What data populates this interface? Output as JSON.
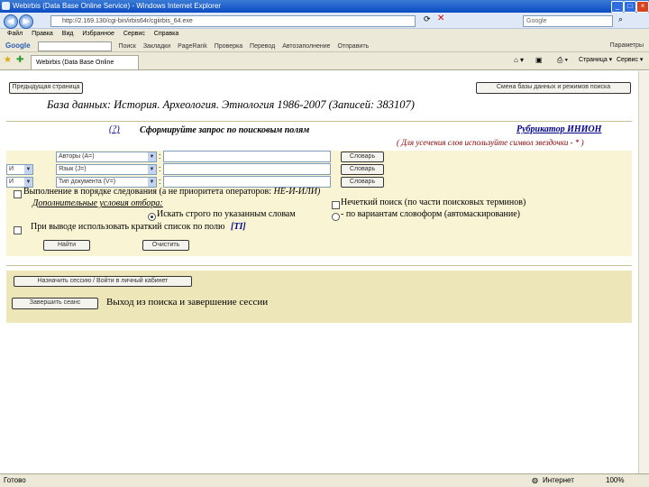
{
  "window": {
    "title": "Webirbis (Data Base Online Service) - Windows Internet Explorer"
  },
  "address": {
    "url": "http://2.169.130/cgi-bin/irbis64r/cgiirbis_64.exe",
    "search_placeholder": "Google"
  },
  "menu": [
    "Файл",
    "Правка",
    "Вид",
    "Избранное",
    "Сервис",
    "Справка"
  ],
  "google_bar": {
    "logo": "Google",
    "items": [
      "G",
      "Поиск",
      "Закладки",
      "PageRank",
      "Проверка",
      "Перевод",
      "Автозаполнение",
      "Отправить",
      "Параметры"
    ]
  },
  "tab": {
    "title": "Webirbis (Data Base Online Service)"
  },
  "page": {
    "btn_prev_page": "Предыдущая страница",
    "btn_change_db": "Смена базы данных и режимов поиска",
    "db_title": "База данных: История. Археология. Этнология 1986-2007 (Записей: 383107)",
    "help_link": "(?)",
    "form_title": "Сформируйте запрос по поисковым полям",
    "rubricator_link": "Рубрикатор ИНИОН",
    "hint": "( Для усечения слов используйте символ звездочки - * )",
    "rows": [
      {
        "op": "",
        "field": "Авторы (A=)",
        "btn": "Словарь"
      },
      {
        "op": "И",
        "field": "Язык (J=)",
        "btn": "Словарь"
      },
      {
        "op": "И",
        "field": "Тип документа (V=)",
        "btn": "Словарь"
      }
    ],
    "opt_order": "Выполнение в порядке следования (а не приоритета операторов:",
    "opt_order_ops": "НЕ-И-ИЛИ)",
    "fuzzy_search": "Нечеткий поиск (по части поисковых терминов)",
    "extra_conditions": "Дополнительные условия отбора:",
    "strict_search": "Искать строго по указанным словам",
    "wordform_search": "- по вариантам словоформ (автомаскирование)",
    "short_list": "При выводе использовать краткий список по полю",
    "short_list_field": "[TI]",
    "btn_find": "Найти",
    "btn_clear": "Очистить",
    "btn_export": "Назначить сессию / Войти в личный кабинет",
    "btn_finish": "Завершить сеанс",
    "exit_text": "Выход из поиска и завершение сессии"
  },
  "status": {
    "left": "Готово",
    "zone": "Интернет",
    "zoom": "100%"
  }
}
